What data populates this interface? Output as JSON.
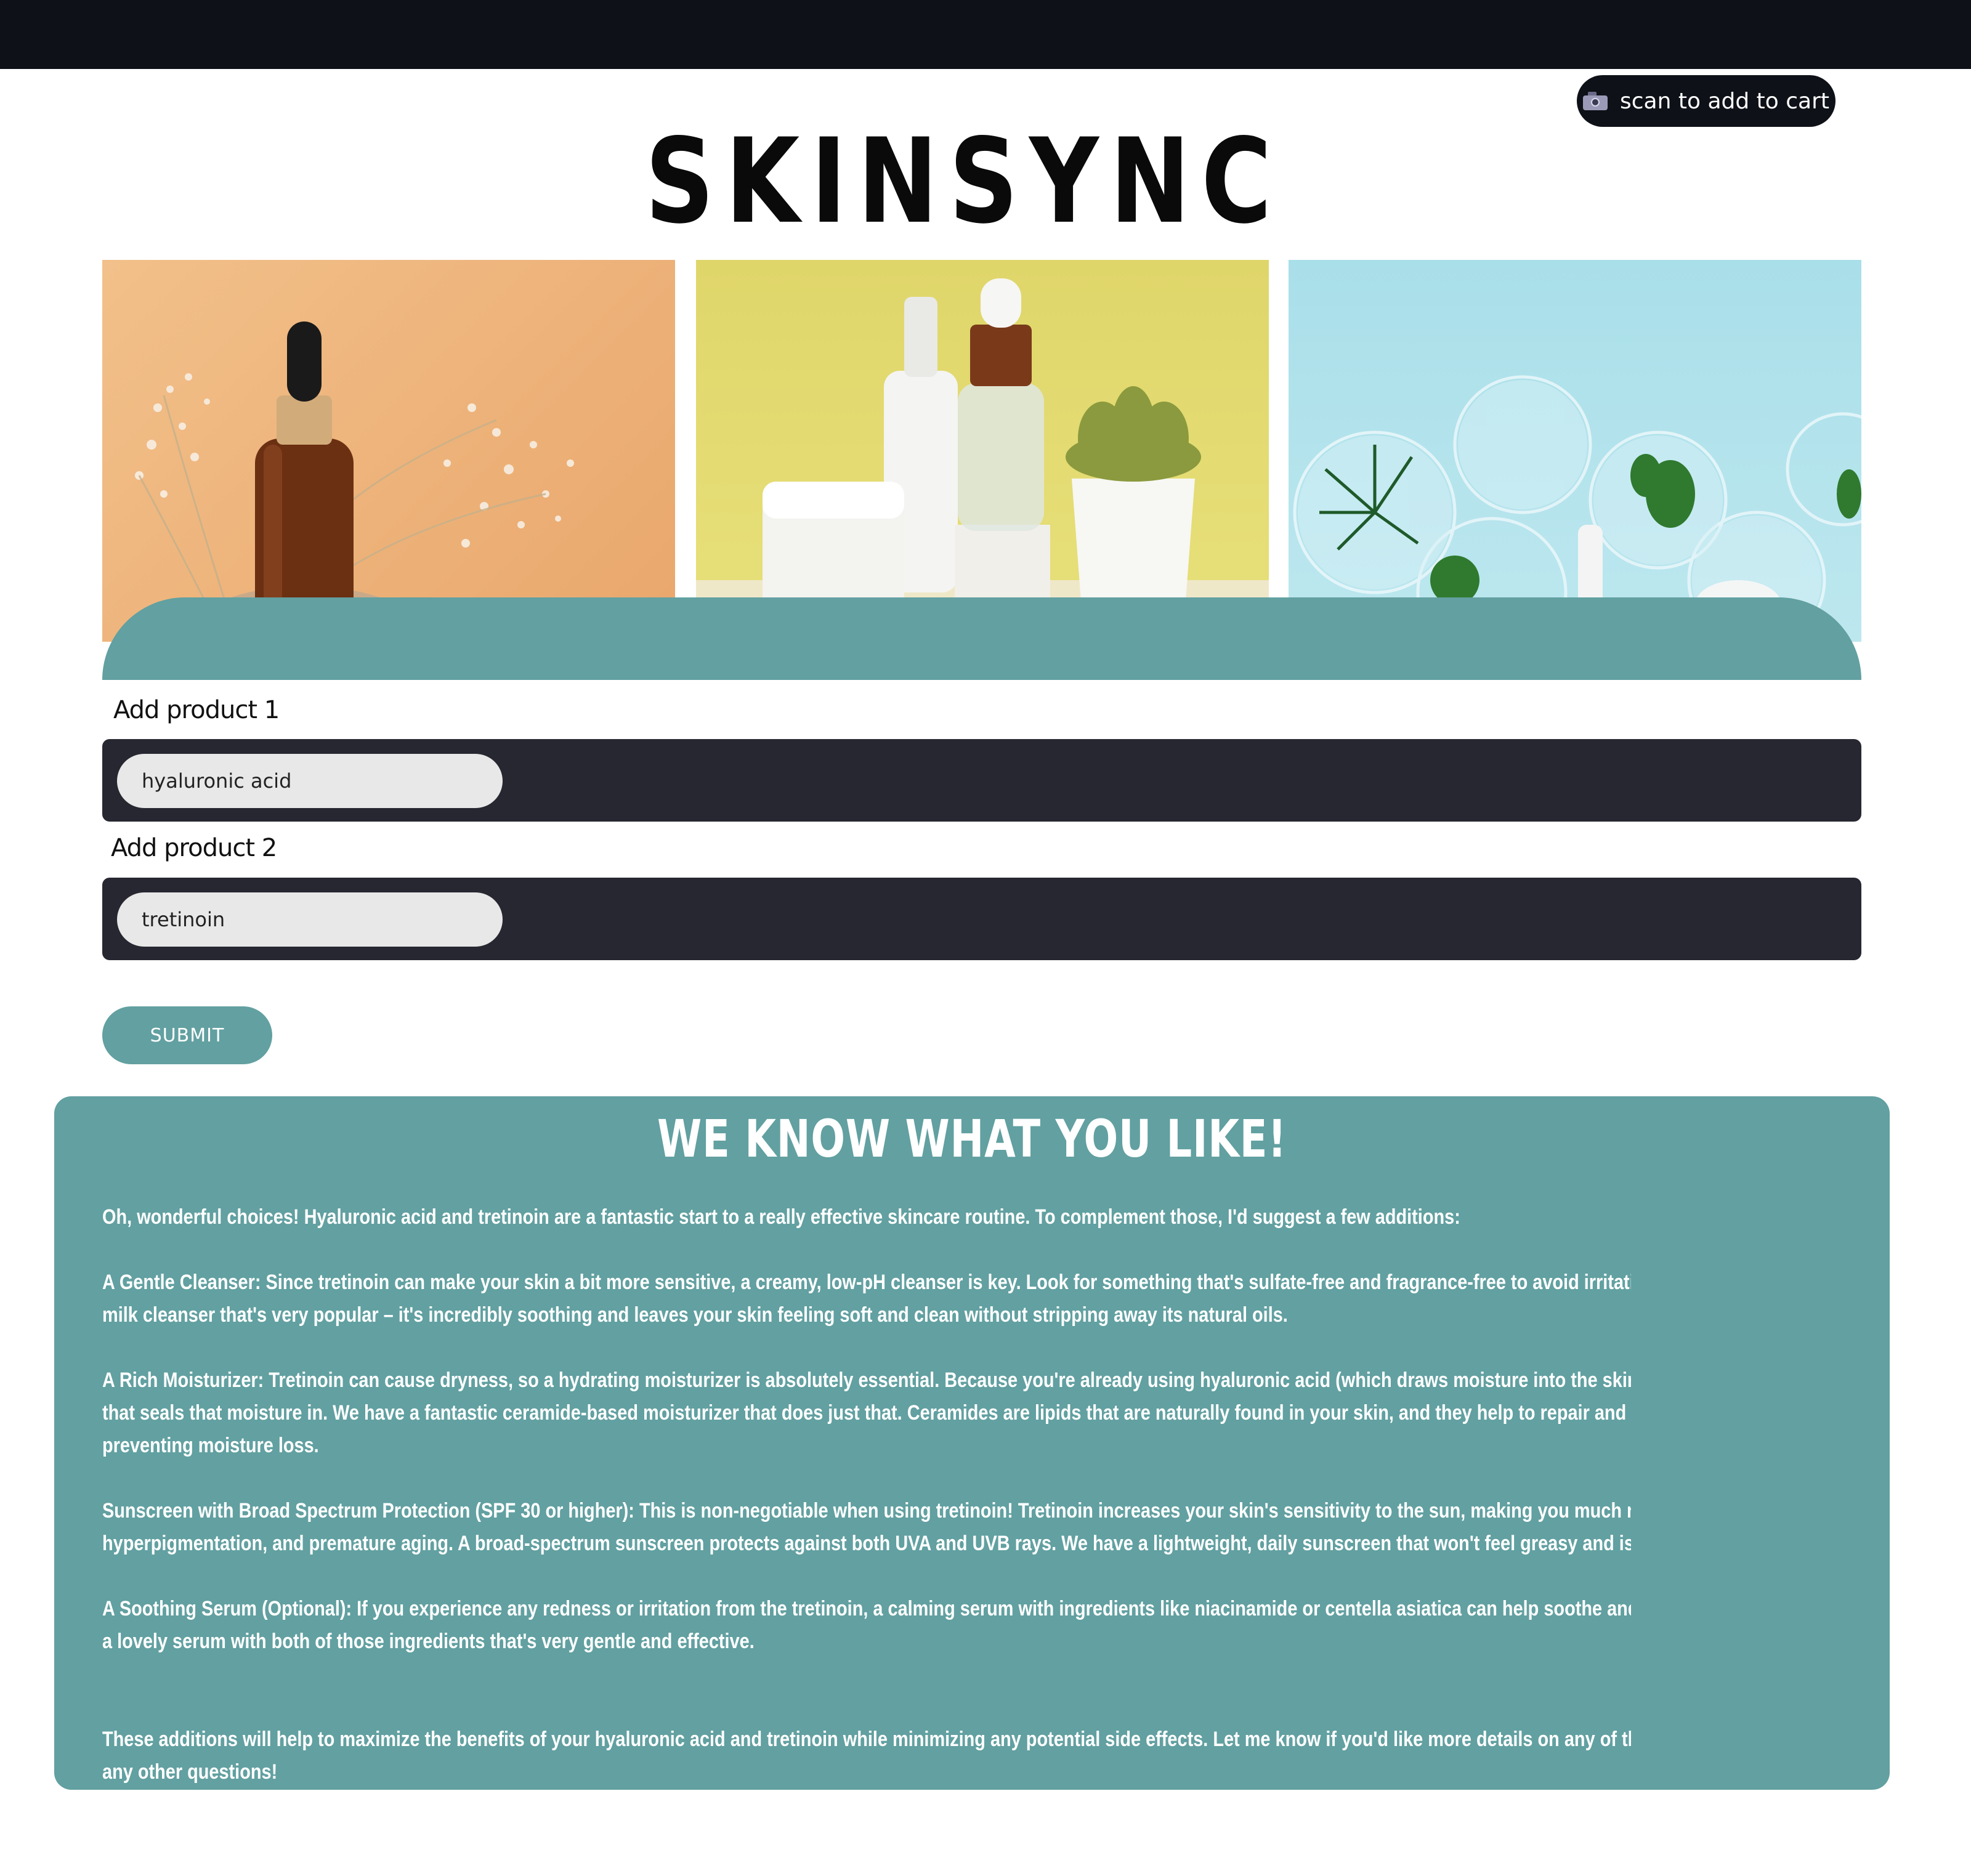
{
  "header": {
    "scan_button": "scan to add to cart",
    "scan_icon": "camera-icon"
  },
  "brand": {
    "logo": "SKINSYNC"
  },
  "hero_images": [
    {
      "alt": "amber dropper bottle with dried flowers"
    },
    {
      "alt": "white skincare bottles with succulent"
    },
    {
      "alt": "petri dishes with herbs on blue"
    }
  ],
  "form": {
    "product1_label": "Add product 1",
    "product1_value": "hyaluronic acid",
    "product2_label": "Add product 2",
    "product2_value": "tretinoin",
    "submit_label": "SUBMIT"
  },
  "recommendations": {
    "title": "WE KNOW WHAT YOU LIKE!",
    "lines": [
      "Oh, wonderful choices! Hyaluronic acid and tretinoin are a fantastic start to a really effective skincare routine. To complement those, I'd suggest a few additions:",
      "A Gentle Cleanser: Since tretinoin can make your skin a bit more sensitive, a creamy, low-pH cleanser is key. Look for something that's sulfate-free and fragrance-free to avoid irritation. We have a lovely oat",
      "milk cleanser that's very popular – it's incredibly soothing and leaves your skin feeling soft and clean without stripping away its natural oils.",
      "A Rich Moisturizer: Tretinoin can cause dryness, so a hydrating moisturizer is absolutely essential. Because you're already using hyaluronic acid (which draws moisture into the skin), you'll want a moisturizer",
      "that seals that moisture in. We have a fantastic ceramide-based moisturizer that does just that. Ceramides are lipids that are naturally found in your skin, and they help to repair and strengthen the skin barrie",
      "preventing moisture loss.",
      "Sunscreen with Broad Spectrum Protection (SPF 30 or higher): This is non-negotiable when using tretinoin! Tretinoin increases your skin's sensitivity to the sun, making you much more prone to sun damage,",
      "hyperpigmentation, and premature aging. A broad-spectrum sunscreen protects against both UVA and UVB rays. We have a lightweight, daily sunscreen that won't feel greasy and is perfect for under makeup.",
      "A Soothing Serum (Optional): If you experience any redness or irritation from the tretinoin, a calming serum with ingredients like niacinamide or centella asiatica can help soothe and repair your skin. We have",
      "a lovely serum with both of those ingredients that's very gentle and effective.",
      "These additions will help to maximize the benefits of your hyaluronic acid and tretinoin while minimizing any potential side effects. Let me know if you'd like more details on any of these products, or if you hav",
      "any other questions!"
    ]
  }
}
